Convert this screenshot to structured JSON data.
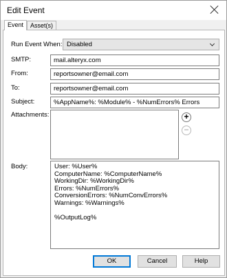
{
  "window": {
    "title": "Edit Event"
  },
  "tabs": [
    {
      "label": "Event",
      "active": true
    },
    {
      "label": "Asset(s)",
      "active": false
    }
  ],
  "form": {
    "run_event_when": {
      "label": "Run Event When:",
      "value": "Disabled"
    },
    "smtp": {
      "label": "SMTP:",
      "value": "mail.alteryx.com"
    },
    "from": {
      "label": "From:",
      "value": "reportsowner@email.com"
    },
    "to": {
      "label": "To:",
      "value": "reportsowner@email.com"
    },
    "subject": {
      "label": "Subject:",
      "value": "%AppName%: %Module% - %NumErrors% Errors"
    },
    "attachments": {
      "label": "Attachments:",
      "add_symbol": "+",
      "remove_symbol": "−"
    },
    "body": {
      "label": "Body:",
      "lines": [
        "User: %User%",
        "ComputerName: %ComputerName%",
        "WorkingDir: %WorkingDir%",
        "Errors: %NumErrors%",
        "ConversionErrors: %NumConvErrors%",
        "Warnings: %Warnings%",
        "",
        "%OutputLog%"
      ]
    }
  },
  "buttons": {
    "ok": "OK",
    "cancel": "Cancel",
    "help": "Help"
  },
  "icons": {
    "close": "close-icon",
    "dropdown": "chevron-down-icon",
    "add": "add-circle-icon",
    "remove": "remove-circle-icon"
  },
  "colors": {
    "accent": "#0078d7"
  }
}
